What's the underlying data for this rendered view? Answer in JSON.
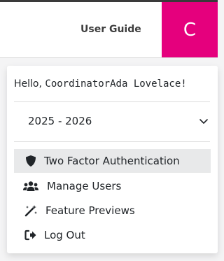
{
  "header": {
    "user_guide_label": "User Guide",
    "avatar_initial": "C",
    "avatar_color": "#e5007d"
  },
  "dropdown": {
    "greeting_prefix": "Hello, ",
    "greeting_name": "CoordinatorAda Lovelace!",
    "school_year": "2025 - 2026",
    "school_year_icon": "chevron-down-icon",
    "menu_items": [
      {
        "label": "Two Factor Authentication",
        "icon": "shield-icon",
        "active": true
      },
      {
        "label": "Manage Users",
        "icon": "users-icon",
        "active": false
      },
      {
        "label": "Feature Previews",
        "icon": "magic-wand-icon",
        "active": false
      },
      {
        "label": "Log Out",
        "icon": "sign-out-icon",
        "active": false
      }
    ],
    "active_background": "#e8e9ea"
  }
}
